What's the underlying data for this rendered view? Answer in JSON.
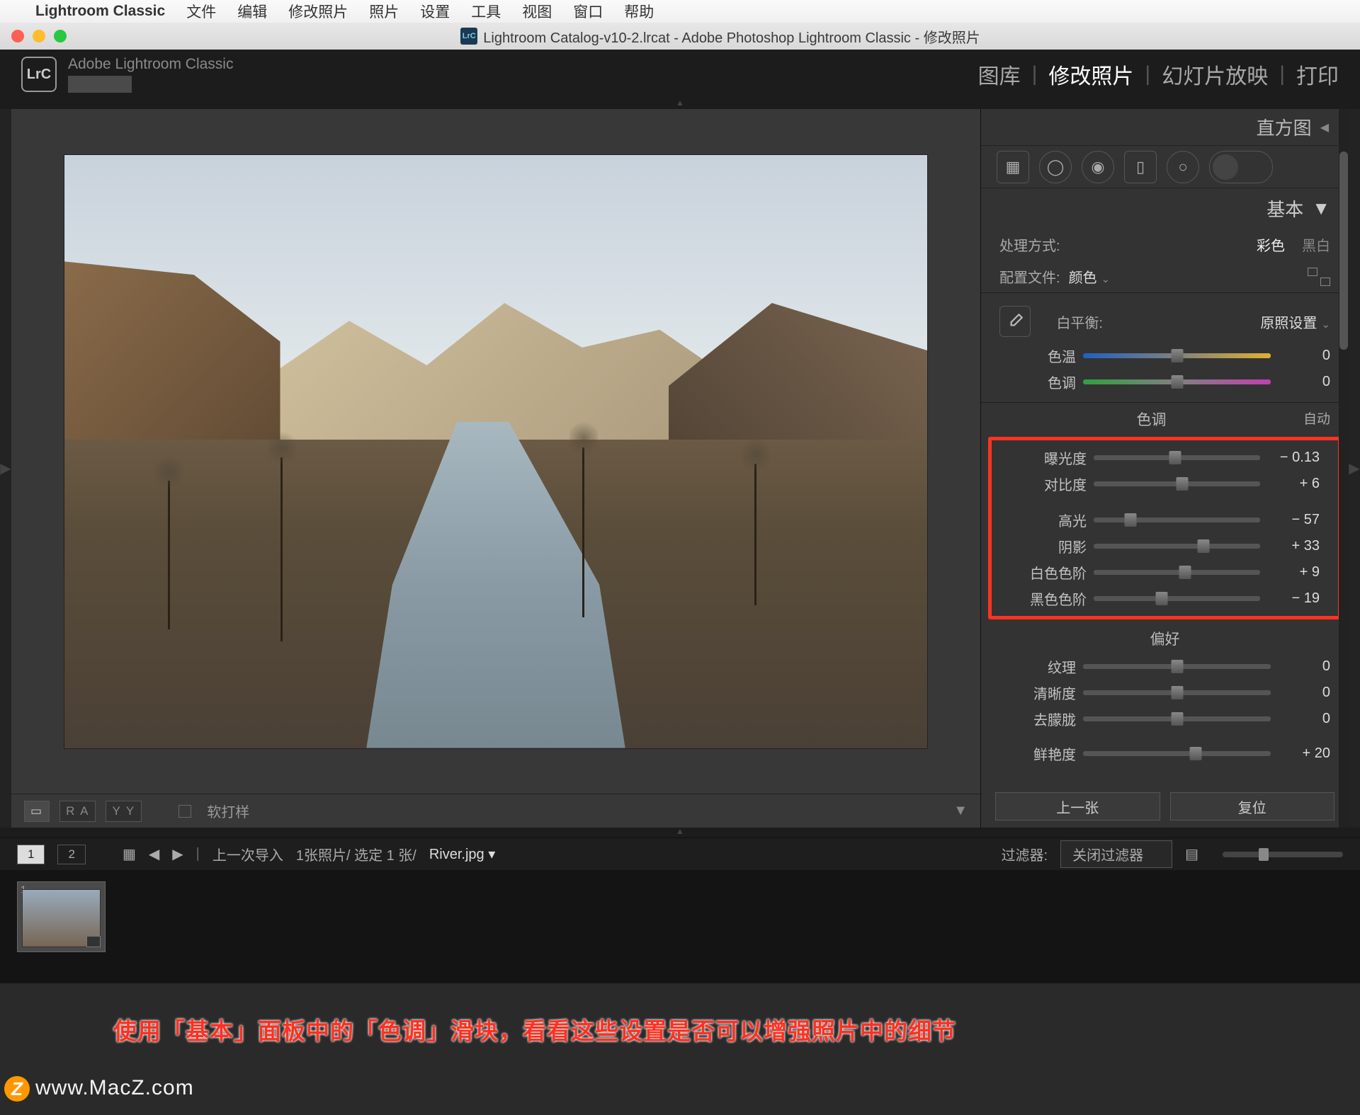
{
  "mac_menu": {
    "app": "Lightroom Classic",
    "items": [
      "文件",
      "编辑",
      "修改照片",
      "照片",
      "设置",
      "工具",
      "视图",
      "窗口",
      "帮助"
    ]
  },
  "titlebar": {
    "icon": "LrC",
    "text": "Lightroom Catalog-v10-2.lrcat - Adobe Photoshop Lightroom Classic - 修改照片"
  },
  "identity": {
    "logo": "LrC",
    "name": "Adobe Lightroom Classic"
  },
  "modules": {
    "items": [
      "图库",
      "修改照片",
      "幻灯片放映",
      "打印"
    ],
    "active": "修改照片"
  },
  "bottom_bar": {
    "soft_proof": "软打样"
  },
  "right": {
    "histogram": "直方图",
    "basic_title": "基本",
    "treatment": {
      "label": "处理方式:",
      "color": "彩色",
      "bw": "黑白"
    },
    "profile": {
      "label": "配置文件:",
      "value": "颜色"
    },
    "wb": {
      "label": "白平衡:",
      "value": "原照设置"
    },
    "sliders_wb": [
      {
        "label": "色温",
        "value": "0",
        "pos": 50,
        "cls": "track-temp"
      },
      {
        "label": "色调",
        "value": "0",
        "pos": 50,
        "cls": "track-tint"
      }
    ],
    "tone": {
      "head": "色调",
      "auto": "自动"
    },
    "sliders_tone": [
      {
        "label": "曝光度",
        "value": "− 0.13",
        "pos": 49
      },
      {
        "label": "对比度",
        "value": "+ 6",
        "pos": 53
      },
      {
        "label": "高光",
        "value": "− 57",
        "pos": 22
      },
      {
        "label": "阴影",
        "value": "+ 33",
        "pos": 66
      },
      {
        "label": "白色色阶",
        "value": "+ 9",
        "pos": 55
      },
      {
        "label": "黑色色阶",
        "value": "− 19",
        "pos": 41
      }
    ],
    "presence": {
      "head": "偏好"
    },
    "sliders_presence": [
      {
        "label": "纹理",
        "value": "0",
        "pos": 50
      },
      {
        "label": "清晰度",
        "value": "0",
        "pos": 50
      },
      {
        "label": "去朦胧",
        "value": "0",
        "pos": 50
      }
    ],
    "sliders_vibrance": [
      {
        "label": "鲜艳度",
        "value": "+ 20",
        "pos": 60
      }
    ],
    "prev": "上一张",
    "reset": "复位"
  },
  "filter_row": {
    "pages": [
      "1",
      "2"
    ],
    "crumb": "上一次导入",
    "count": "1张照片/ 选定 1 张/",
    "file": "River.jpg",
    "filter_label": "过滤器:",
    "filter_value": "关闭过滤器"
  },
  "annotation": "使用「基本」面板中的「色调」滑块，看看这些设置是否可以增强照片中的细节",
  "watermark": "www.MacZ.com"
}
